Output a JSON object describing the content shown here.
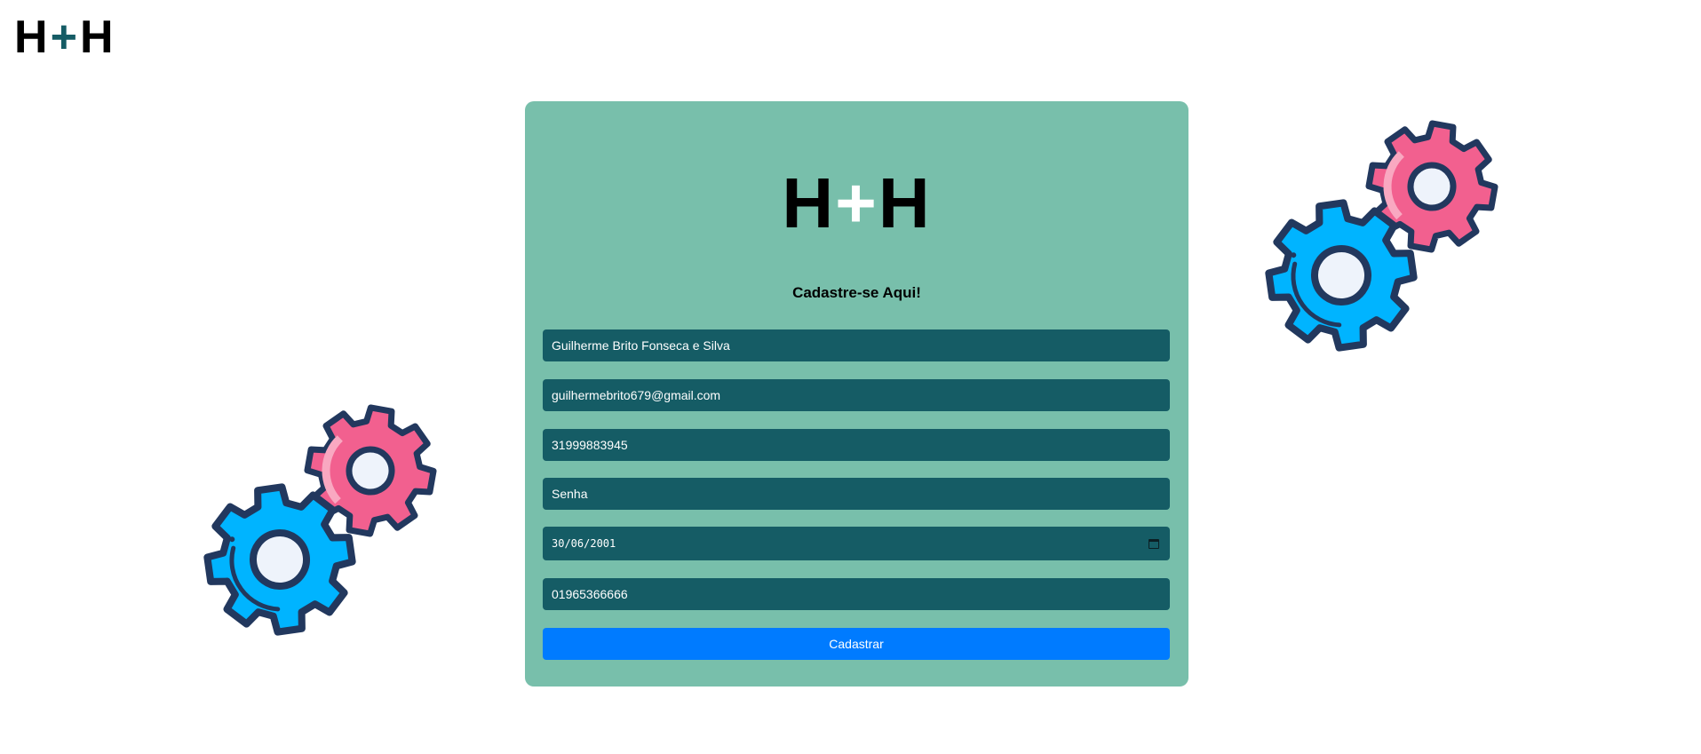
{
  "header": {
    "brand_left": "H",
    "brand_plus": "+",
    "brand_right": "H"
  },
  "card": {
    "logo_left": "H",
    "logo_plus": "+",
    "logo_right": "H",
    "heading": "Cadastre-se Aqui!",
    "fields": {
      "name": "Guilherme Brito Fonseca e Silva",
      "email": "guilhermebrito679@gmail.com",
      "phone": "31999883945",
      "password_placeholder": "Senha",
      "birthdate": "30/06/2001",
      "document": "01965366666"
    },
    "submit_label": "Cadastrar"
  },
  "colors": {
    "card_bg": "#78bfab",
    "field_bg": "#155c65",
    "button_bg": "#007bff",
    "gear_blue": "#00b4ff",
    "gear_pink": "#f2608f",
    "gear_outline": "#22385e"
  },
  "icons": [
    "gears-illustration-left",
    "gears-illustration-right",
    "calendar-icon"
  ]
}
